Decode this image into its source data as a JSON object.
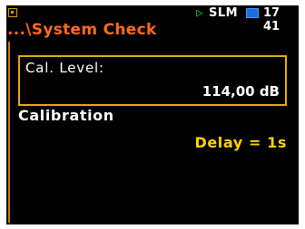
{
  "status_bar": {
    "system_icon": "menu-icon",
    "run_icon": "play-icon",
    "mode": "SLM",
    "battery_icon": "battery-icon",
    "time": "17 41"
  },
  "screen": {
    "title": "...\\System Check",
    "cal_level": {
      "label": "Cal. Level:",
      "value": "114,00 dB"
    },
    "calibration": {
      "heading": "Calibration",
      "delay": "Delay = 1s"
    }
  },
  "colors": {
    "background": "#000000",
    "title": "#ff6a1a",
    "highlight_border": "#e6b000",
    "value_text": "#ffd200",
    "run_indicator": "#1fcf3f",
    "battery": "#1a6fe0"
  }
}
